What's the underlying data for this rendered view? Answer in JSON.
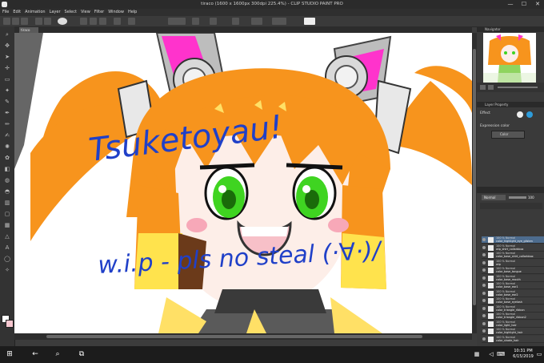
{
  "window": {
    "title": "tiraco (1600 x 1600px 300dpi 225.4%) - CLIP STUDIO PAINT PRO",
    "minimize": "—",
    "maximize": "☐",
    "close": "✕"
  },
  "menu": [
    "File",
    "Edit",
    "Animation",
    "Layer",
    "Select",
    "View",
    "Filter",
    "Window",
    "Help"
  ],
  "tabs": [
    {
      "label": "tiraco"
    }
  ],
  "canvas": {
    "handwriting_line1": "Tsuketoyau!",
    "handwriting_line2": "w.i.p - pls no steal (·∀·)/"
  },
  "navigator": {
    "title": "Navigator"
  },
  "layer_property": {
    "title": "Layer Property",
    "effect_label": "Effect",
    "expression_color_label": "Expression color",
    "color_value": "Color"
  },
  "layer_panel": {
    "blend_mode": "Normal",
    "opacity": "100"
  },
  "layers": [
    {
      "mode": "100 % Normal",
      "name": "color_highlight_eye_glisten",
      "selected": true
    },
    {
      "mode": "100 % Normal",
      "name": "wip_shirt_collarbbox",
      "selected": false
    },
    {
      "mode": "100 % Normal",
      "name": "color_base_shirt_collarbbox",
      "selected": false
    },
    {
      "mode": "100 % Normal",
      "name": "wip",
      "selected": false
    },
    {
      "mode": "100 % Normal",
      "name": "color_base_tongue",
      "selected": false
    },
    {
      "mode": "100 % Normal",
      "name": "color_base_mouth",
      "selected": false
    },
    {
      "mode": "100 % Normal",
      "name": "color_base_ear1",
      "selected": false
    },
    {
      "mode": "100 % Normal",
      "name": "color_base_ear2",
      "selected": false
    },
    {
      "mode": "100 % Normal",
      "name": "color_base_eyelash",
      "selected": false
    },
    {
      "mode": "100 % Normal",
      "name": "color_triangle_ribbon",
      "selected": false
    },
    {
      "mode": "100 % Normal",
      "name": "color_triangle_ribbon2",
      "selected": false
    },
    {
      "mode": "100 % Normal",
      "name": "color_light_hair",
      "selected": false
    },
    {
      "mode": "100 % Normal",
      "name": "color_highlight_hair",
      "selected": false
    },
    {
      "mode": "100 % Normal",
      "name": "color_shade_hair",
      "selected": false
    }
  ],
  "taskbar": {
    "time": "10:31 PM",
    "date": "6/15/2019"
  },
  "colors": {
    "hair": "#f7941d",
    "hair_light": "#fcbf49",
    "hair_dark": "#6b3a1a",
    "eye": "#3fd421",
    "ear_pink": "#ff33cc",
    "handwriting": "#2040c8",
    "selected_layer": "#4d6c8e"
  }
}
